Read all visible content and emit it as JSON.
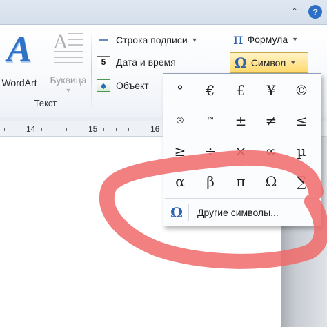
{
  "titlebar": {
    "up_icon": "chevron-up-icon",
    "help_icon": "help-icon",
    "help_glyph": "?",
    "up_glyph": "⌃"
  },
  "ribbon": {
    "wordart_label": "WordArt",
    "dropcap_label": "Буквица",
    "group_label": "Текст",
    "caption_label": "Строка подписи",
    "date_label": "Дата и время",
    "object_label": "Объект",
    "formula_label": "Формула",
    "symbol_label": "Символ",
    "date_icon_text": "5"
  },
  "ruler": {
    "labels": [
      "14",
      "15",
      "16"
    ]
  },
  "symbols": {
    "grid": [
      [
        "°",
        "€",
        "£",
        "¥",
        "©"
      ],
      [
        "®",
        "™",
        "±",
        "≠",
        "≤"
      ],
      [
        "≥",
        "÷",
        "×",
        "∞",
        "µ"
      ],
      [
        "α",
        "β",
        "π",
        "Ω",
        "∑"
      ]
    ],
    "more_label": "Другие символы...",
    "more_icon": "Ω"
  },
  "colors": {
    "accent": "#2e62b0",
    "annotation": "#f06a6a",
    "highlight": "#ffd96b"
  }
}
